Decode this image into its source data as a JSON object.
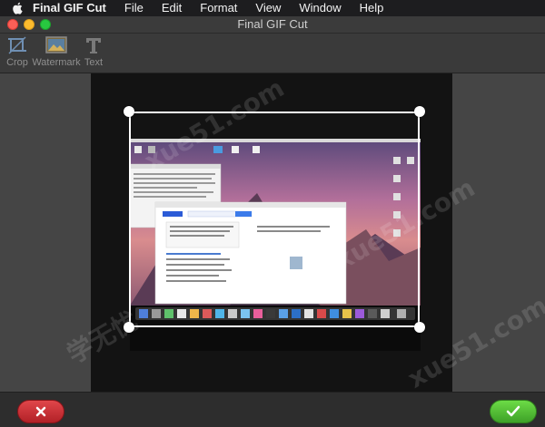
{
  "menubar": {
    "app_name": "Final GIF Cut",
    "items": [
      "File",
      "Edit",
      "Format",
      "View",
      "Window",
      "Help"
    ]
  },
  "window": {
    "title": "Final GIF Cut"
  },
  "toolbar": {
    "tools": [
      {
        "label": "Crop",
        "icon": "crop-icon"
      },
      {
        "label": "Watermark",
        "icon": "image-icon"
      },
      {
        "label": "Text",
        "icon": "text-icon"
      }
    ]
  },
  "watermarks": [
    "xue51.com",
    "xue51.com",
    "xue51.com",
    "学无忧"
  ],
  "actions": {
    "cancel_icon": "x-icon",
    "confirm_icon": "checkmark-icon"
  },
  "colors": {
    "menubar": "#1d1d1f",
    "cancel": "#c9262b",
    "confirm": "#4db832",
    "stage": "#131313"
  }
}
